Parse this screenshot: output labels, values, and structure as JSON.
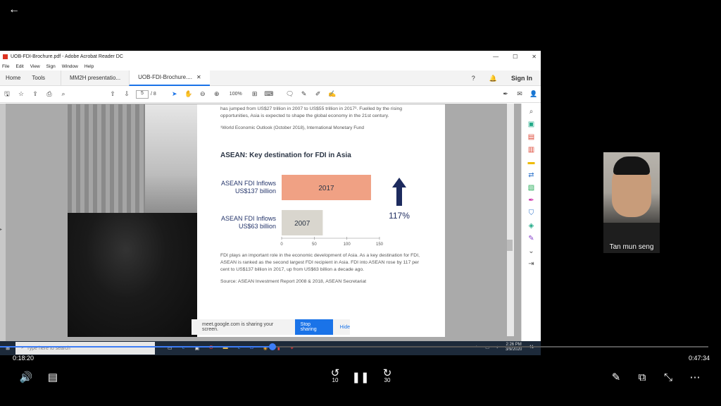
{
  "player": {
    "back_icon": "arrow-left-icon",
    "current_time": "0:18:20",
    "total_time": "0:47:34",
    "progress_fraction": 0.385,
    "controls": {
      "volume_icon": "volume-icon",
      "captions_icon": "captions-icon",
      "rewind_label": "10",
      "pause_icon": "pause-icon",
      "forward_label": "30",
      "edit_icon": "pencil-icon",
      "pip_icon": "picture-in-picture-icon",
      "minimize_icon": "collapse-icon",
      "more_icon": "more-icon"
    }
  },
  "acrobat": {
    "window_title": "UOB-FDI-Brochure.pdf - Adobe Acrobat Reader DC",
    "menu": [
      "File",
      "Edit",
      "View",
      "Sign",
      "Window",
      "Help"
    ],
    "nav_tabs": [
      "Home",
      "Tools"
    ],
    "doc_tabs": [
      "MM2H presentatio...",
      "UOB-FDI-Brochure...."
    ],
    "sign_in": "Sign In",
    "page_current": "5",
    "page_total": "/ 8",
    "zoom": "100%"
  },
  "pdf": {
    "intro_text": "has jumped from US$27 trillion in 2007 to US$55 trillion in 2017¹. Fuelled by the rising opportunities, Asia is expected to shape the global economy in the 21st century.",
    "footnote": "¹World Economic Outlook (October 2018), International Monetary Fund",
    "heading": "ASEAN: Key destination for FDI in Asia",
    "body_text": "FDI plays an important role in the economic development of Asia. As a key destination for FDI, ASEAN is ranked as the second largest FDI recipient in Asia. FDI into ASEAN rose by 117 per cent to US$137 billion in 2017, up from US$63 billion a decade ago.",
    "source": "Source: ASEAN Investment Report 2008 & 2018, ASEAN Secretariat"
  },
  "chart_data": {
    "type": "bar",
    "orientation": "horizontal",
    "categories": [
      "2017",
      "2007"
    ],
    "values": [
      137,
      63
    ],
    "row_labels": [
      [
        "ASEAN FDI Inflows",
        "US$137 billion"
      ],
      [
        "ASEAN FDI Inflows",
        "US$63 billion"
      ]
    ],
    "bar_colors": [
      "#f0a184",
      "#d9d6ce"
    ],
    "xlim": [
      0,
      150
    ],
    "xticks": [
      0,
      50,
      100,
      150
    ],
    "annotation": "117%",
    "annotation_icon": "arrow-up-icon"
  },
  "share_bar": {
    "message": "meet.google.com is sharing your screen.",
    "stop": "Stop sharing",
    "hide": "Hide"
  },
  "taskbar": {
    "search_placeholder": "Type here to search",
    "time": "2:26 PM",
    "date": "3/9/2020",
    "notification_count": "41"
  },
  "participant": {
    "name": "Tan mun seng"
  }
}
